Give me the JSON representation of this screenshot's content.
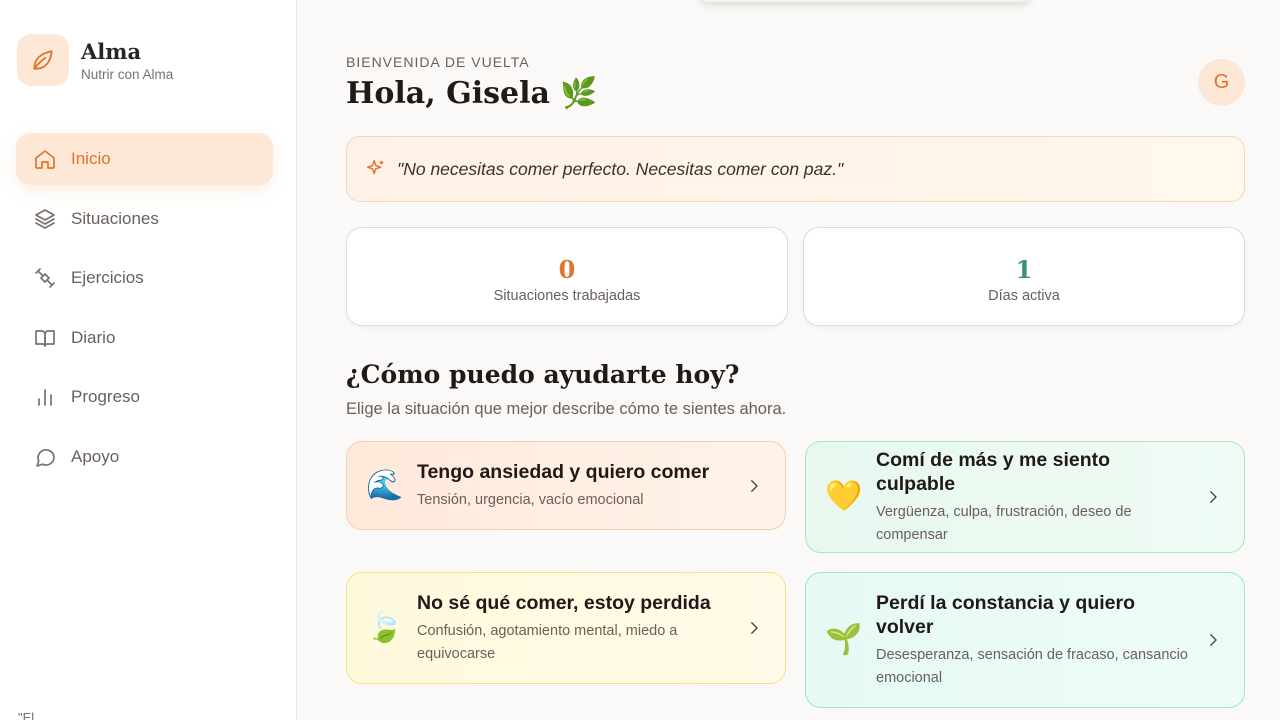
{
  "brand": {
    "name": "Alma",
    "subtitle": "Nutrir con Alma",
    "icon": "leaf-icon",
    "accent": "#e0742a"
  },
  "nav": {
    "items": [
      {
        "label": "Inicio",
        "icon": "home-icon",
        "active": true
      },
      {
        "label": "Situaciones",
        "icon": "layers-icon"
      },
      {
        "label": "Ejercicios",
        "icon": "exercise-icon"
      },
      {
        "label": "Diario",
        "icon": "book-icon"
      },
      {
        "label": "Progreso",
        "icon": "bar-chart-icon"
      },
      {
        "label": "Apoyo",
        "icon": "chat-bubble-icon"
      }
    ]
  },
  "sidebar_footer": "\"El",
  "header": {
    "eyebrow": "BIENVENIDA DE VUELTA",
    "greeting": "Hola, Gisela 🌿",
    "avatar_initial": "G"
  },
  "quote": {
    "icon": "sparkle-icon",
    "text": "\"No necesitas comer perfecto. Necesitas comer con paz.\""
  },
  "stats": [
    {
      "value": "0",
      "label": "Situaciones trabajadas",
      "color": "#e0742a"
    },
    {
      "value": "1",
      "label": "Días activa",
      "color": "#3f8f7a"
    }
  ],
  "help": {
    "title": "¿Cómo puedo ayudarte hoy?",
    "subtitle": "Elige la situación que mejor describe cómo te sientes ahora."
  },
  "situations": [
    {
      "emoji": "🌊",
      "title": "Tengo ansiedad y quiero comer",
      "desc": "Tensión, urgencia, vacío emocional"
    },
    {
      "emoji": "💛",
      "title": "Comí de más y me siento culpable",
      "desc": "Vergüenza, culpa, frustración, deseo de compensar"
    },
    {
      "emoji": "🍃",
      "title": "No sé qué comer, estoy perdida",
      "desc": "Confusión, agotamiento mental, miedo a equivocarse"
    },
    {
      "emoji": "🌱",
      "title": "Perdí la constancia y quiero volver",
      "desc": "Desesperanza, sensación de fracaso, cansancio emocional"
    }
  ]
}
